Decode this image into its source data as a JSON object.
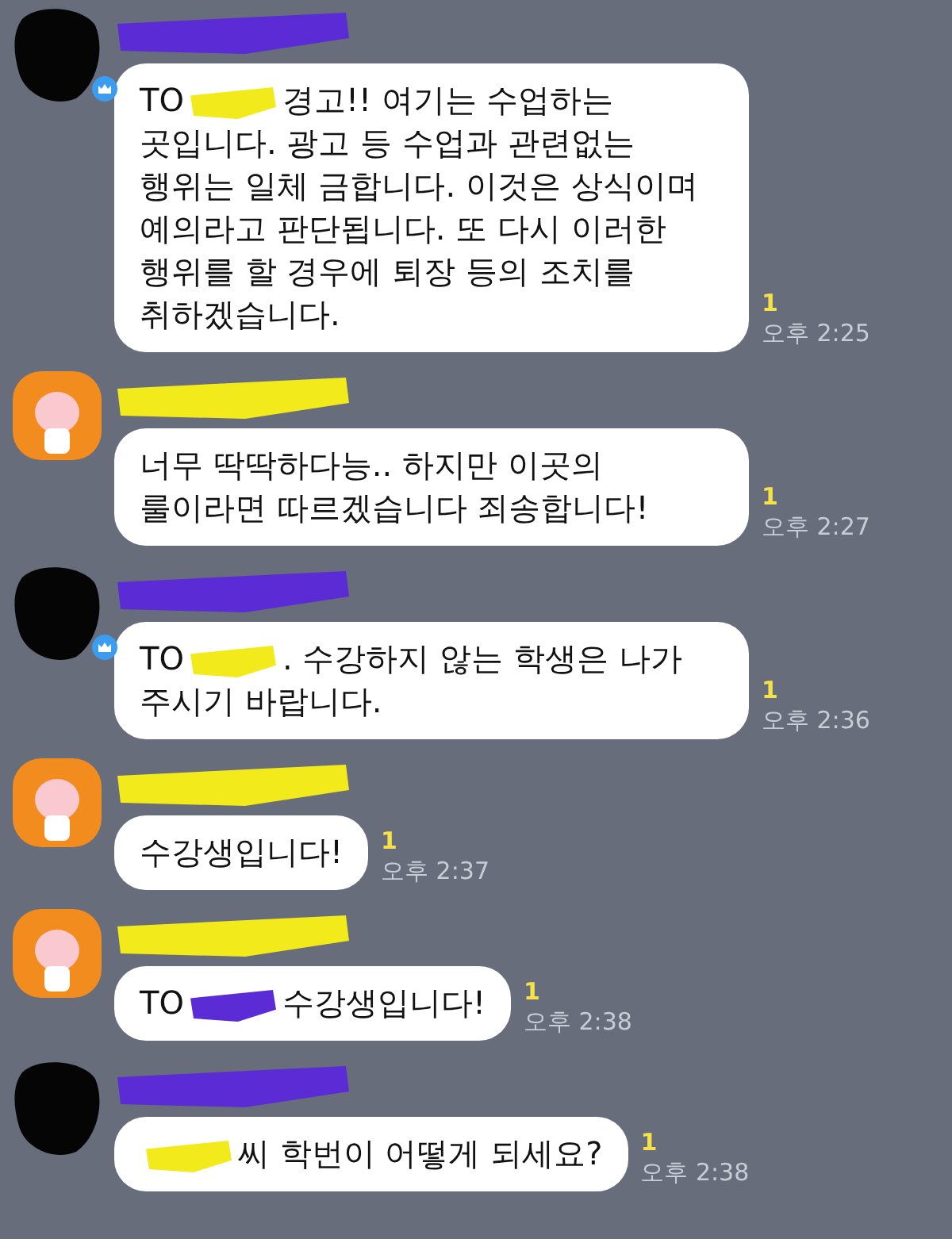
{
  "messages": [
    {
      "avatar": {
        "kind": "redacted",
        "host": true
      },
      "name_redaction": {
        "color": "#5b2bd6"
      },
      "parts": [
        {
          "kind": "text",
          "text": "TO"
        },
        {
          "kind": "redaction",
          "color": "#f2ea1a"
        },
        {
          "kind": "text",
          "text": "경고!! 여기는 수업하는 곳입니다. 광고 등 수업과 관련없는 행위는 일체 금합니다. 이것은 상식이며 예의라고 판단됩니다. 또 다시 이러한 행위를 할 경우에 퇴장 등의 조치를 취하겠습니다."
        }
      ],
      "unread": "1",
      "time": "오후 2:25"
    },
    {
      "avatar": {
        "kind": "character",
        "host": false
      },
      "name_redaction": {
        "color": "#f2ea1a"
      },
      "parts": [
        {
          "kind": "text",
          "text": "너무 딱딱하다능.. 하지만 이곳의 룰이라면 따르겠습니다 죄송합니다!"
        }
      ],
      "unread": "1",
      "time": "오후 2:27"
    },
    {
      "avatar": {
        "kind": "redacted",
        "host": true
      },
      "name_redaction": {
        "color": "#5b2bd6"
      },
      "parts": [
        {
          "kind": "text",
          "text": "TO"
        },
        {
          "kind": "redaction",
          "color": "#f2ea1a"
        },
        {
          "kind": "text",
          "text": ". 수강하지 않는 학생은 나가 주시기 바랍니다."
        }
      ],
      "unread": "1",
      "time": "오후 2:36"
    },
    {
      "avatar": {
        "kind": "character",
        "host": false
      },
      "name_redaction": {
        "color": "#f2ea1a"
      },
      "parts": [
        {
          "kind": "text",
          "text": "수강생입니다!"
        }
      ],
      "unread": "1",
      "time": "오후 2:37"
    },
    {
      "avatar": {
        "kind": "character",
        "host": false
      },
      "name_redaction": {
        "color": "#f2ea1a"
      },
      "parts": [
        {
          "kind": "text",
          "text": "TO"
        },
        {
          "kind": "redaction",
          "color": "#5b2bd6"
        },
        {
          "kind": "text",
          "text": "수강생입니다!"
        }
      ],
      "unread": "1",
      "time": "오후 2:38"
    },
    {
      "avatar": {
        "kind": "redacted",
        "host": false
      },
      "name_redaction": {
        "color": "#5b2bd6"
      },
      "parts": [
        {
          "kind": "redaction",
          "color": "#f2ea1a"
        },
        {
          "kind": "text",
          "text": "씨 학번이 어떻게 되세요?"
        }
      ],
      "unread": "1",
      "time": "오후 2:38"
    }
  ]
}
